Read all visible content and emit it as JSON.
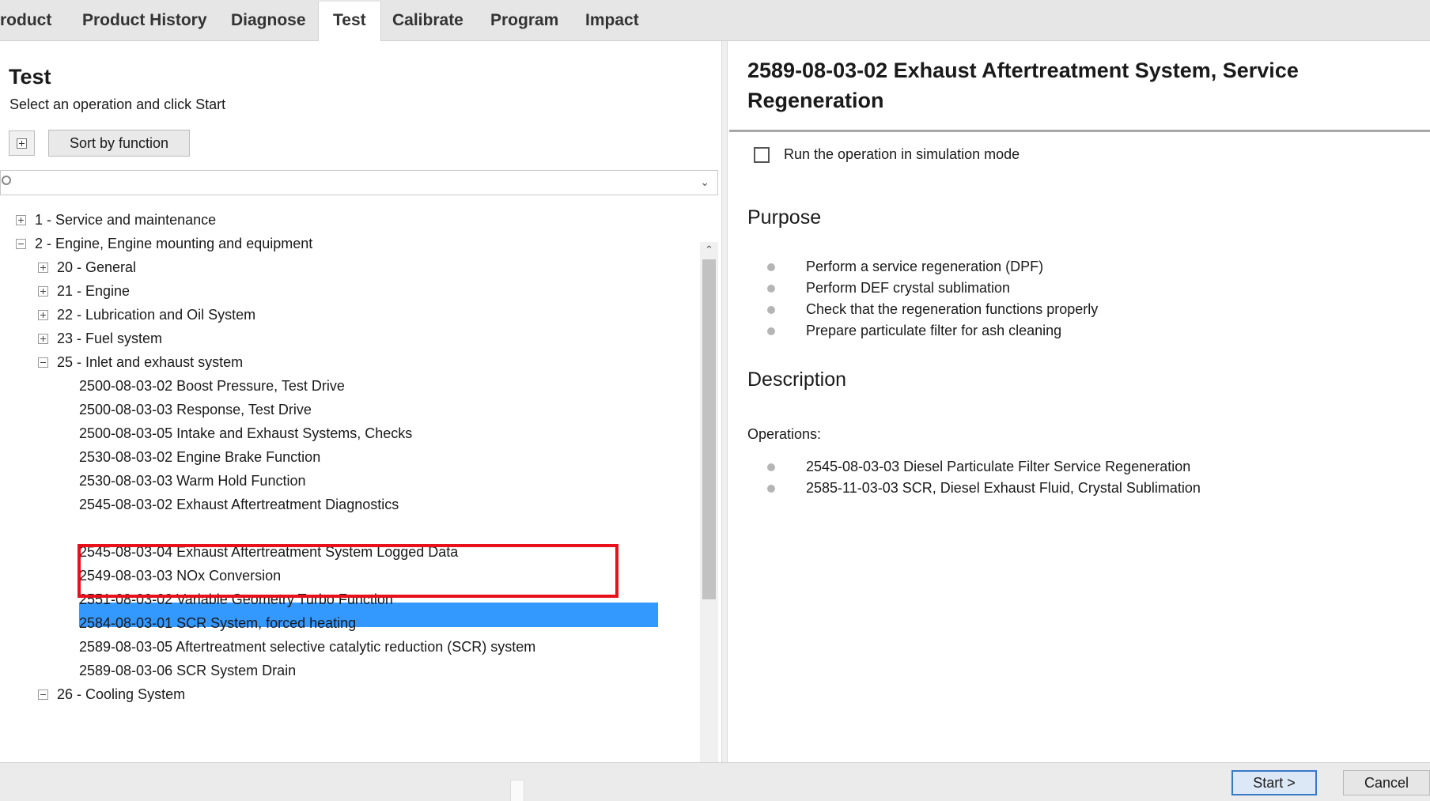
{
  "tabs": [
    {
      "label": "roduct"
    },
    {
      "label": "Product History"
    },
    {
      "label": "Diagnose"
    },
    {
      "label": "Test",
      "active": true
    },
    {
      "label": "Calibrate"
    },
    {
      "label": "Program"
    },
    {
      "label": "Impact"
    }
  ],
  "left": {
    "title": "Test",
    "subtitle": "Select an operation and click Start",
    "sort_button": "Sort by function",
    "tree": [
      {
        "label": "1 - Service and maintenance",
        "icon": "plus"
      },
      {
        "label": "2 - Engine, Engine mounting and equipment",
        "icon": "minus"
      },
      {
        "label": "20 - General",
        "icon": "plus"
      },
      {
        "label": "21 - Engine",
        "icon": "plus"
      },
      {
        "label": "22 - Lubrication and Oil System",
        "icon": "plus"
      },
      {
        "label": "23 - Fuel system",
        "icon": "plus"
      },
      {
        "label": "25 - Inlet and exhaust system",
        "icon": "minus"
      },
      {
        "label": "2500-08-03-02 Boost Pressure, Test Drive"
      },
      {
        "label": "2500-08-03-03 Response, Test Drive"
      },
      {
        "label": "2500-08-03-05 Intake and Exhaust Systems, Checks"
      },
      {
        "label": "2530-08-03-02 Engine Brake Function"
      },
      {
        "label": "2530-08-03-03 Warm Hold Function"
      },
      {
        "label": "2545-08-03-02 Exhaust Aftertreatment Diagnostics"
      },
      {
        "label": "2589-08-03-02 Exhaust Aftertreatment System, Service Regeneration",
        "selected": true
      },
      {
        "label": "2545-08-03-04 Exhaust Aftertreatment System Logged Data"
      },
      {
        "label": "2549-08-03-03 NOx Conversion"
      },
      {
        "label": "2551-08-03-02 Variable Geometry Turbo Function"
      },
      {
        "label": "2584-08-03-01 SCR System, forced heating"
      },
      {
        "label": "2589-08-03-05 Aftertreatment selective catalytic reduction (SCR) system"
      },
      {
        "label": "2589-08-03-06 SCR System Drain"
      },
      {
        "label": "26 - Cooling System",
        "icon": "minus"
      }
    ]
  },
  "right": {
    "title": "2589-08-03-02 Exhaust Aftertreatment System, Service Regeneration",
    "simulation_label": "Run the operation in simulation mode",
    "purpose_heading": "Purpose",
    "purpose_items": [
      "Perform a service regeneration (DPF)",
      "Perform DEF crystal sublimation",
      "Check that the regeneration functions properly",
      "Prepare particulate filter for ash cleaning"
    ],
    "description_heading": "Description",
    "operations_label": "Operations:",
    "operations": [
      "2545-08-03-03 Diesel Particulate Filter Service Regeneration",
      "2585-11-03-03 SCR, Diesel Exhaust Fluid, Crystal Sublimation"
    ]
  },
  "footer": {
    "start_label": "Start >",
    "cancel_label": "Cancel"
  },
  "colors": {
    "selection": "#3399ff",
    "highlight_box": "#e8101a"
  }
}
